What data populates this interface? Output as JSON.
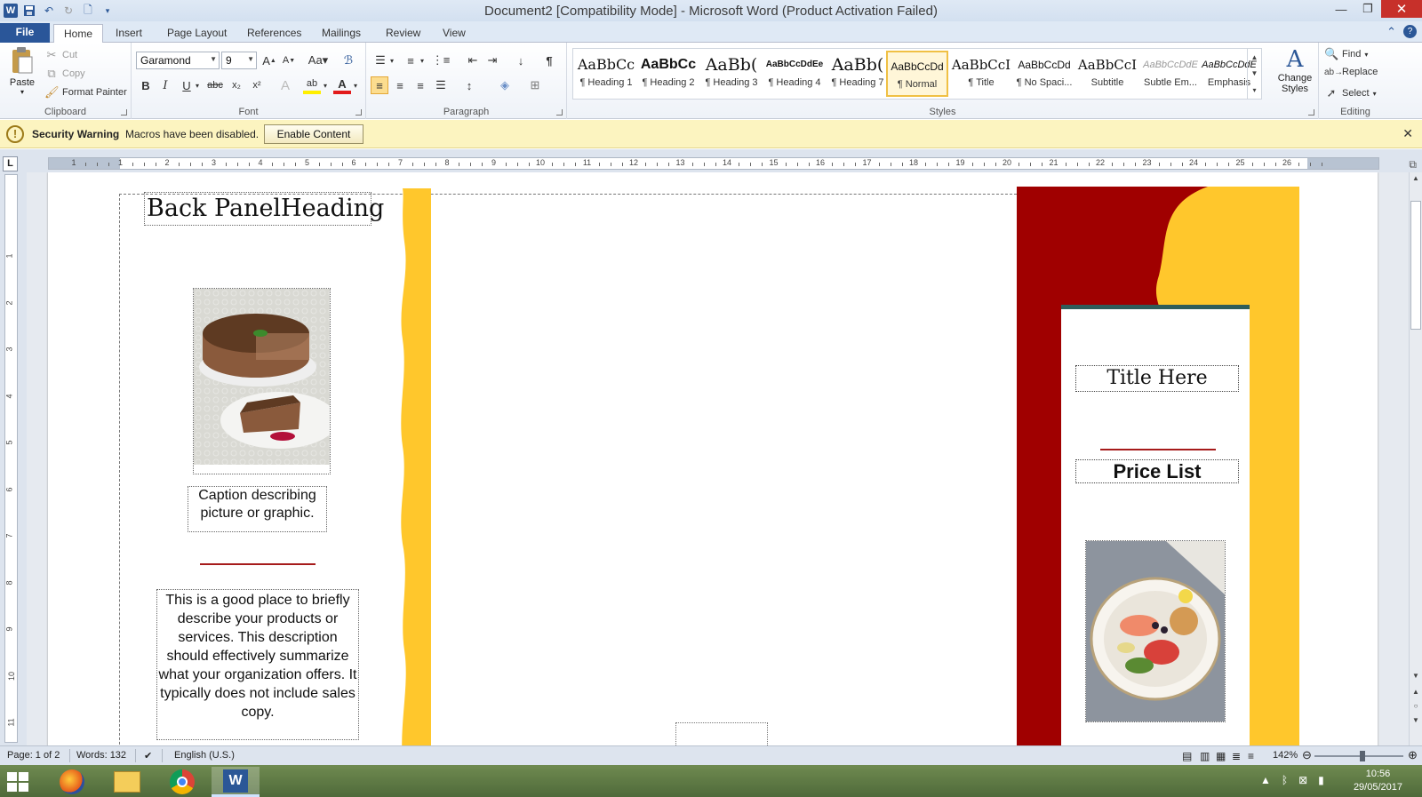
{
  "window": {
    "title": "Document2 [Compatibility Mode]  -  Microsoft Word (Product Activation Failed)",
    "minimize": "—",
    "restore": "❐",
    "close": "✕"
  },
  "tabs": {
    "file": "File",
    "items": [
      "Home",
      "Insert",
      "Page Layout",
      "References",
      "Mailings",
      "Review",
      "View"
    ]
  },
  "clipboard": {
    "label": "Clipboard",
    "paste": "Paste",
    "cut": "Cut",
    "copy": "Copy",
    "format_painter": "Format Painter"
  },
  "font": {
    "label": "Font",
    "name": "Garamond",
    "size": "9"
  },
  "paragraph": {
    "label": "Paragraph"
  },
  "styles": {
    "label": "Styles",
    "items": [
      {
        "sample": "AaBbCc",
        "name": "¶ Heading 1"
      },
      {
        "sample": "AaBbCc",
        "name": "¶ Heading 2"
      },
      {
        "sample": "AaBb(",
        "name": "¶ Heading 3"
      },
      {
        "sample": "AaBbCcDdEe",
        "name": "¶ Heading 4"
      },
      {
        "sample": "AaBb(",
        "name": "¶ Heading 7"
      },
      {
        "sample": "AaBbCcDd",
        "name": "¶ Normal"
      },
      {
        "sample": "AaBbCcI",
        "name": "¶ Title"
      },
      {
        "sample": "AaBbCcDd",
        "name": "¶ No Spaci..."
      },
      {
        "sample": "AaBbCcI",
        "name": "Subtitle"
      },
      {
        "sample": "AaBbCcDdE",
        "name": "Subtle Em..."
      },
      {
        "sample": "AaBbCcDdE",
        "name": "Emphasis"
      }
    ],
    "change_styles": "Change Styles"
  },
  "editing": {
    "label": "Editing",
    "find": "Find",
    "replace": "Replace",
    "select": "Select"
  },
  "security": {
    "title": "Security Warning",
    "message": "Macros have been disabled.",
    "button": "Enable Content"
  },
  "ruler": {
    "numbers": [
      "1",
      "1",
      "2",
      "3",
      "4",
      "5",
      "6",
      "7",
      "8",
      "9",
      "10",
      "11",
      "12",
      "13",
      "14",
      "15",
      "16",
      "17",
      "18",
      "19",
      "20",
      "21",
      "22",
      "23",
      "24",
      "25",
      "26"
    ],
    "vnumbers": [
      "1",
      "2",
      "3",
      "4",
      "5",
      "6",
      "7",
      "8",
      "9",
      "10",
      "11"
    ],
    "tab_selector": "L"
  },
  "document": {
    "back_heading": "Back PanelHeading",
    "caption": "Caption describing picture or graphic.",
    "description": "This is a good place to briefly describe your products or services. This description should effectively summarize what your organization offers. It typically does not include sales copy.",
    "title_here": "Title Here",
    "price_list": "Price List"
  },
  "status": {
    "page": "Page: 1 of 2",
    "words": "Words: 132",
    "language": "English (U.S.)",
    "zoom": "142%"
  },
  "taskbar": {
    "time": "10:56",
    "date": "29/05/2017"
  },
  "colors": {
    "accent_red": "#a00000",
    "accent_yellow": "#ffc72c",
    "ribbon_file": "#2a5699"
  }
}
